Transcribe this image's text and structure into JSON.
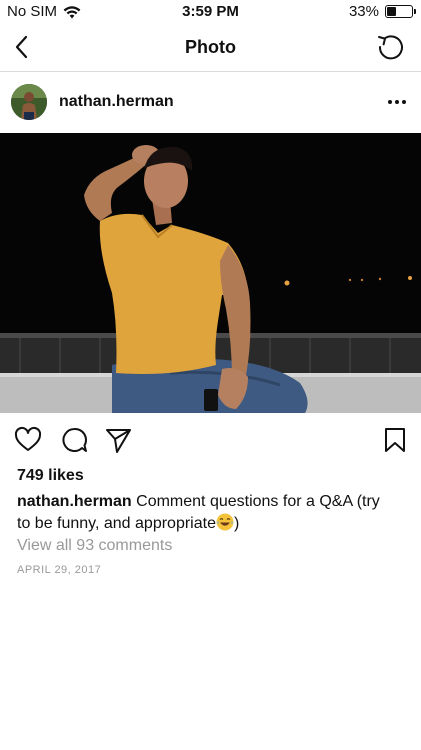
{
  "status_bar": {
    "carrier": "No SIM",
    "time": "3:59 PM",
    "battery": "33%",
    "battery_level": 0.33
  },
  "nav": {
    "title": "Photo",
    "back_icon": "chevron-left-icon",
    "refresh_icon": "refresh-icon"
  },
  "post": {
    "username": "nathan.herman",
    "more_icon": "more-horizontal-icon",
    "likes": "749 likes",
    "caption_user": "nathan.herman",
    "caption_line1": "Comment questions for a Q&A (try",
    "caption_line2": "to be funny, and appropriate",
    "caption_end": ")",
    "caption_emoji": "laughing-crying-emoji",
    "view_comments": "View all 93 comments",
    "date": "APRIL 29, 2017"
  },
  "actions": {
    "like_icon": "heart-icon",
    "comment_icon": "comment-icon",
    "share_icon": "send-icon",
    "save_icon": "bookmark-icon"
  }
}
